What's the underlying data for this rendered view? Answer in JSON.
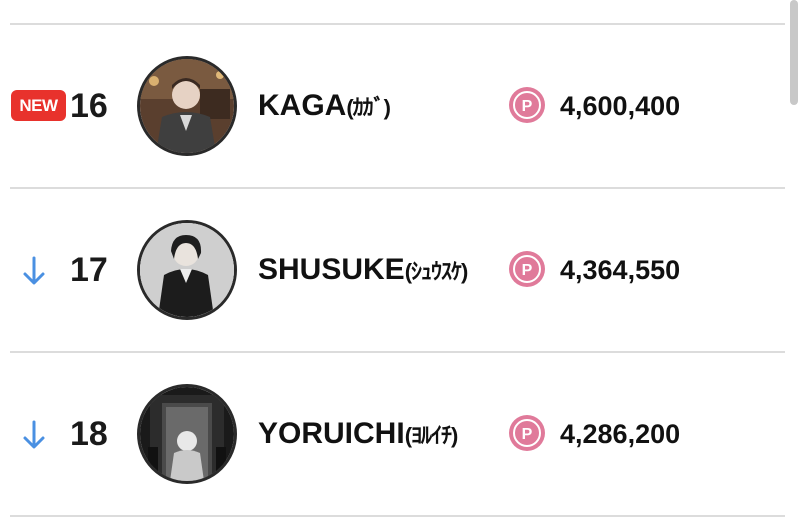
{
  "colors": {
    "new_badge": "#e8322c",
    "arrow_down": "#4a90e2",
    "point_icon": "#e07a9a",
    "divider": "#dcdcdc"
  },
  "ranking": [
    {
      "badge": "NEW",
      "trend": "new",
      "rank": "16",
      "name": "KAGA",
      "kana": "(ｶｶﾞ)",
      "point_icon": "P",
      "points": "4,600,400"
    },
    {
      "trend": "down",
      "trend_icon": "arrow-down-icon",
      "rank": "17",
      "name": "SHUSUKE",
      "kana": "(ｼｭｳｽｹ)",
      "point_icon": "P",
      "points": "4,364,550"
    },
    {
      "trend": "down",
      "trend_icon": "arrow-down-icon",
      "rank": "18",
      "name": "YORUICHI",
      "kana": "(ﾖﾙｲﾁ)",
      "point_icon": "P",
      "points": "4,286,200"
    }
  ]
}
